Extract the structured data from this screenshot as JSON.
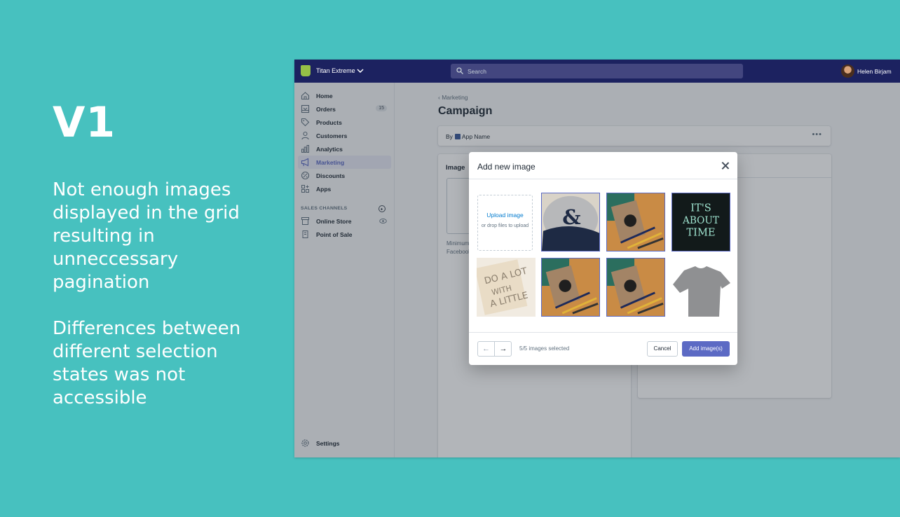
{
  "annotation": {
    "version": "V1",
    "point1": "Not enough images displayed in the grid resulting in unneccessary pagination",
    "point2": "Differences between different selection states was not accessible"
  },
  "topbar": {
    "store_name": "Titan Extreme",
    "search_placeholder": "Search",
    "user_name": "Helen Birjam"
  },
  "sidebar": {
    "items": [
      {
        "label": "Home",
        "icon": "home-icon"
      },
      {
        "label": "Orders",
        "icon": "orders-icon",
        "badge": "15"
      },
      {
        "label": "Products",
        "icon": "tag-icon"
      },
      {
        "label": "Customers",
        "icon": "person-icon"
      },
      {
        "label": "Analytics",
        "icon": "bar-chart-icon"
      },
      {
        "label": "Marketing",
        "icon": "megaphone-icon",
        "active": true
      },
      {
        "label": "Discounts",
        "icon": "discount-icon"
      },
      {
        "label": "Apps",
        "icon": "apps-icon"
      }
    ],
    "sales_channels_title": "SALES CHANNELS",
    "channels": [
      {
        "label": "Online Store",
        "icon": "store-icon"
      },
      {
        "label": "Point of Sale",
        "icon": "pos-icon"
      }
    ],
    "settings_label": "Settings"
  },
  "page": {
    "breadcrumb": "Marketing",
    "title": "Campaign",
    "by_label": "By",
    "app_name": "App Name",
    "image_section_title": "Image",
    "min_text_line1": "Minimum",
    "min_text_line2": "Facebook"
  },
  "modal": {
    "title": "Add new image",
    "upload_label": "Upload image",
    "upload_hint": "or drop files to upload",
    "images": [
      {
        "name": "cap",
        "selected": true
      },
      {
        "name": "notebook-desk",
        "selected": true
      },
      {
        "name": "its-about-time",
        "selected": true
      },
      {
        "name": "do-a-lot-with-a-little",
        "selected": false
      },
      {
        "name": "notebook-desk-2",
        "selected": true
      },
      {
        "name": "notebook-desk-3",
        "selected": true
      },
      {
        "name": "grey-tshirt",
        "selected": false
      }
    ],
    "selection_status": "5/5 images selected",
    "cancel_label": "Cancel",
    "add_label": "Add image(s)",
    "prev_arrow": "←",
    "next_arrow": "→"
  },
  "colors": {
    "background": "#47c1bf",
    "topbar": "#1c2260",
    "primary": "#5c6ac4",
    "link": "#007ace"
  }
}
